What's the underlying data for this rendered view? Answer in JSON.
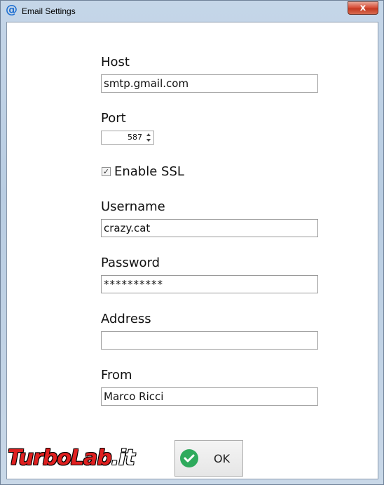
{
  "window": {
    "title": "Email Settings",
    "app_icon": "at-sign-icon",
    "close_label": "x"
  },
  "form": {
    "host_label": "Host",
    "host_value": "smtp.gmail.com",
    "port_label": "Port",
    "port_value": "587",
    "ssl_label": "Enable SSL",
    "ssl_checked": true,
    "username_label": "Username",
    "username_value": "crazy.cat",
    "password_label": "Password",
    "password_value": "**********",
    "address_label": "Address",
    "address_value": "",
    "from_label": "From",
    "from_value": "Marco Ricci"
  },
  "buttons": {
    "ok_label": "OK"
  },
  "watermark": {
    "part1": "TurboLab",
    "part2": ".it"
  },
  "colors": {
    "accent": "#1f6fd1",
    "ok_green": "#2eaa5c",
    "close_red": "#c43a22"
  }
}
